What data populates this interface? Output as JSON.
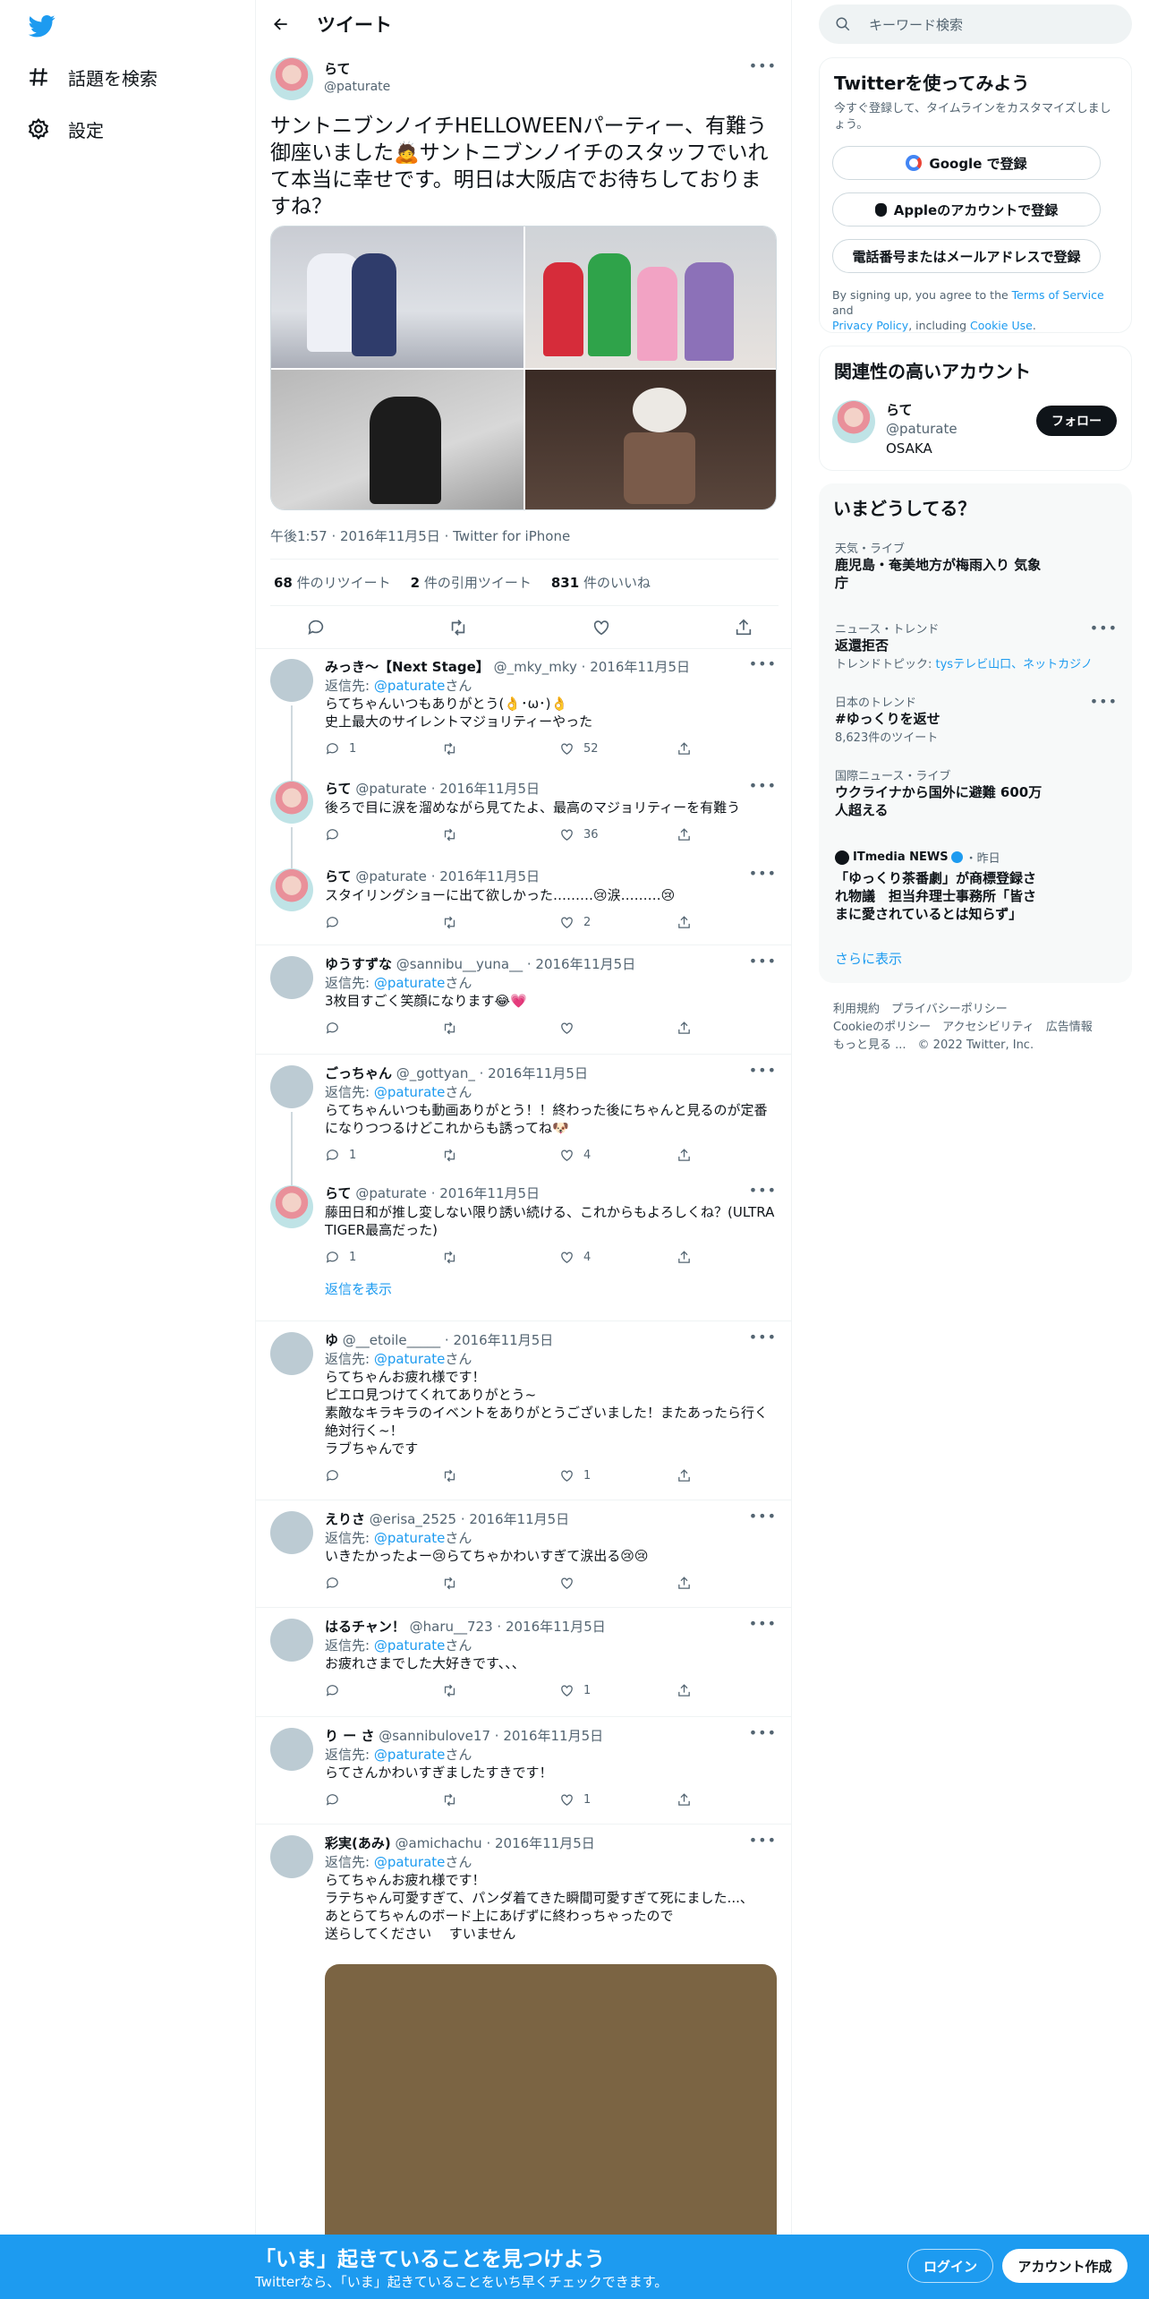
{
  "nav": {
    "explore_label": "話題を検索",
    "settings_label": "設定"
  },
  "header": {
    "title": "ツイート"
  },
  "tweet": {
    "name": "らて",
    "handle": "@paturate",
    "text": "サントニブンノイチHELLOWEENパーティー、有難う御座いました🙇サントニブンノイチのスタッフでいれて本当に幸せです。明日は大阪店でお待ちしておりますね？",
    "time": "午後1:57",
    "date": "2016年11月5日",
    "source": "Twitter for iPhone",
    "retweets": "68",
    "retweets_label": " 件のリツイート",
    "quotes": "2",
    "quotes_label": " 件の引用ツイート",
    "likes": "831",
    "likes_label": " 件のいいね"
  },
  "replies": [
    {
      "name": "みっき〜【Next Stage】",
      "handle": "@_mky_mky",
      "date": "2016年11月5日",
      "reply_prefix": "返信先: ",
      "reply_to": "@paturate",
      "reply_suffix": "さん",
      "lines": [
        "らてちゃんいつもありがとう(👌･ω･)👌",
        "史上最大のサイレントマジョリティーやった"
      ],
      "replies": "1",
      "retweets": "",
      "likes": "52"
    },
    {
      "name": "らて",
      "handle": "@paturate",
      "date": "2016年11月5日",
      "lines": [
        "後ろで目に涙を溜めながら見てたよ、最高のマジョリティーを有難う"
      ],
      "replies": "",
      "retweets": "",
      "likes": "36"
    },
    {
      "name": "らて",
      "handle": "@paturate",
      "date": "2016年11月5日",
      "lines": [
        "スタイリングショーに出て欲しかった………😢涙………😢"
      ],
      "replies": "",
      "retweets": "",
      "likes": "2"
    },
    {
      "name": "ゆうすずな",
      "handle": "@sannibu__yuna__",
      "date": "2016年11月5日",
      "reply_prefix": "返信先: ",
      "reply_to": "@paturate",
      "reply_suffix": "さん",
      "lines": [
        "3枚目すごく笑顔になります😂💗"
      ],
      "replies": "",
      "retweets": "",
      "likes": ""
    },
    {
      "name": "ごっちゃん",
      "handle": "@_gottyan_",
      "date": "2016年11月5日",
      "reply_prefix": "返信先: ",
      "reply_to": "@paturate",
      "reply_suffix": "さん",
      "lines": [
        "らてちゃんいつも動画ありがとう！！終わった後にちゃんと見るのが定番",
        "になりつつるけどこれからも誘ってね🐶"
      ],
      "replies": "1",
      "retweets": "",
      "likes": "4"
    },
    {
      "name": "らて",
      "handle": "@paturate",
      "date": "2016年11月5日",
      "lines": [
        "藤田日和が推し変しない限り誘い続ける、これからもよろしくね？(ULTRA",
        "TIGER最高だった)"
      ],
      "replies": "1",
      "retweets": "",
      "likes": "4",
      "show_replies": "返信を表示"
    },
    {
      "name": "ゆ",
      "handle": "@__etoile_____",
      "date": "2016年11月5日",
      "reply_prefix": "返信先: ",
      "reply_to": "@paturate",
      "reply_suffix": "さん",
      "lines": [
        "らてちゃんお疲れ様です！",
        "ピエロ見つけてくれてありがとう~",
        "素敵なキラキラのイベントをありがとうございました！またあったら行く",
        "絶対行く~！",
        "ラブちゃんです"
      ],
      "replies": "",
      "retweets": "",
      "likes": "1"
    },
    {
      "name": "えりさ",
      "handle": "@erisa_2525",
      "date": "2016年11月5日",
      "reply_prefix": "返信先: ",
      "reply_to": "@paturate",
      "reply_suffix": "さん",
      "lines": [
        "いきたかったよー😢らてちゃかわいすぎて涙出る😢😢"
      ],
      "replies": "",
      "retweets": "",
      "likes": ""
    },
    {
      "name": "はるチャン！",
      "handle": "@haru__723",
      "date": "2016年11月5日",
      "reply_prefix": "返信先: ",
      "reply_to": "@paturate",
      "reply_suffix": "さん",
      "lines": [
        "お疲れさまでした大好きです、、、"
      ],
      "replies": "",
      "retweets": "",
      "likes": "1"
    },
    {
      "name": "り ー さ",
      "handle": "@sannibulove17",
      "date": "2016年11月5日",
      "reply_prefix": "返信先: ",
      "reply_to": "@paturate",
      "reply_suffix": "さん",
      "lines": [
        "らてさんかわいすぎましたすきです！"
      ],
      "replies": "",
      "retweets": "",
      "likes": "1"
    },
    {
      "name": "彩実(あみ)",
      "handle": "@amichachu",
      "date": "2016年11月5日",
      "reply_prefix": "返信先: ",
      "reply_to": "@paturate",
      "reply_suffix": "さん",
      "lines": [
        "らてちゃんお疲れ様です！",
        "ラテちゃん可愛すぎて、パンダ着てきた瞬間可愛すぎて死にました...、",
        "あとらてちゃんのボード上にあげずに終わっちゃったので",
        "送らしてください　 すいません"
      ],
      "replies": "",
      "retweets": "",
      "likes": ""
    }
  ],
  "right": {
    "search_placeholder": "キーワード検索",
    "signup": {
      "title": "Twitterを使ってみよう",
      "subtitle": "今すぐ登録して、タイムラインをカスタマイズしましょう。",
      "google": "Google で登録",
      "apple": "Appleのアカウントで登録",
      "phone": "電話番号またはメールアドレスで登録",
      "terms_1": "By signing up, you agree to the ",
      "terms_link": "Terms of Service",
      "terms_2": " and",
      "privacy_link": "Privacy Policy",
      "terms_3": ", including ",
      "cookie_link": "Cookie Use",
      "terms_4": "."
    },
    "related": {
      "title": "関連性の高いアカウント",
      "name": "らて",
      "handle": "@paturate",
      "bio": "OSAKA",
      "follow": "フォロー"
    },
    "trends": {
      "title": "いまどうしてる？",
      "items": [
        {
          "category": "天気・ライブ",
          "title": "鹿児島・奄美地方が梅雨入り 気象",
          "title2": "庁",
          "sub": ""
        },
        {
          "category": "ニュース・トレンド",
          "title": "返還拒否",
          "sub_prefix": "トレンドトピック: ",
          "sub_links": "tysテレビ山口、ネットカジノ"
        },
        {
          "category": "日本のトレンド",
          "title": "#ゆっくりを返せ",
          "sub": "8,623件のツイート"
        },
        {
          "category": "国際ニュース・ライブ",
          "title": "ウクライナから国外に避難 600万",
          "title2": "人超える",
          "sub": ""
        }
      ],
      "news": {
        "source": "ITmedia NEWS",
        "time": "・昨日",
        "line1": "「ゆっくり茶番劇」が商標登録さ",
        "line2": "れ物議　担当弁理士事務所「皆さ",
        "line3": "まに愛されているとは知らず」"
      },
      "more": "さらに表示"
    },
    "footer": {
      "row1": [
        "利用規約",
        "プライバシーポリシー"
      ],
      "row2": [
        "Cookieのポリシー",
        "アクセシビリティ",
        "広告情報"
      ],
      "row3": [
        "もっと見る ...",
        "© 2022 Twitter, Inc."
      ]
    }
  },
  "bottom": {
    "title": "「いま」起きていることを見つけよう",
    "subtitle": "Twitterなら、「いま」起きていることをいち早くチェックできます。",
    "login": "ログイン",
    "signup": "アカウント作成"
  },
  "colors": {
    "accent": "#1d9bf0",
    "text": "#0f1419",
    "muted": "#536471",
    "border": "#eff3f4"
  }
}
